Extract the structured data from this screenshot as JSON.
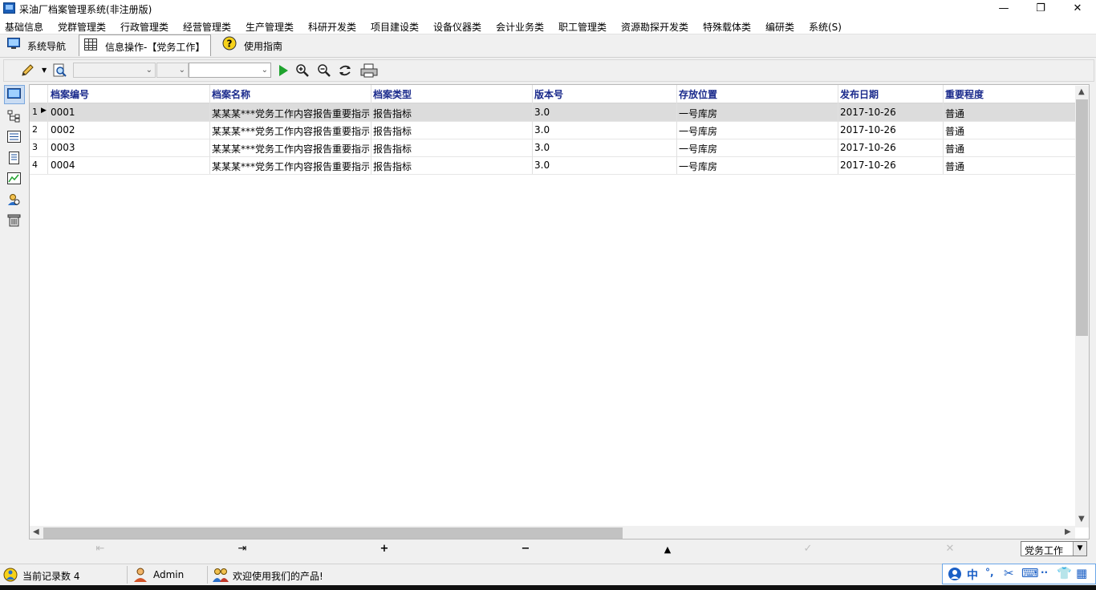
{
  "window": {
    "title": "采油厂档案管理系统(非注册版)",
    "minimize": "—",
    "restore": "❐",
    "close": "✕"
  },
  "menu": [
    "基础信息",
    "党群管理类",
    "行政管理类",
    "经营管理类",
    "生产管理类",
    "科研开发类",
    "项目建设类",
    "设备仪器类",
    "会计业务类",
    "职工管理类",
    "资源勘探开发类",
    "特殊载体类",
    "编研类",
    "系统(S)"
  ],
  "tabs": {
    "nav": "系统导航",
    "info": "信息操作-【党务工作】",
    "guide": "使用指南"
  },
  "table": {
    "columns": [
      "档案编号",
      "档案名称",
      "档案类型",
      "版本号",
      "存放位置",
      "发布日期",
      "重要程度"
    ],
    "rows": [
      {
        "num": "1",
        "id": "0001",
        "name": "某某某***党务工作内容报告重要指示",
        "type": "报告指标",
        "version": "3.0",
        "location": "一号库房",
        "date": "2017-10-26",
        "level": "普通"
      },
      {
        "num": "2",
        "id": "0002",
        "name": "某某某***党务工作内容报告重要指示",
        "type": "报告指标",
        "version": "3.0",
        "location": "一号库房",
        "date": "2017-10-26",
        "level": "普通"
      },
      {
        "num": "3",
        "id": "0003",
        "name": "某某某***党务工作内容报告重要指示",
        "type": "报告指标",
        "version": "3.0",
        "location": "一号库房",
        "date": "2017-10-26",
        "level": "普通"
      },
      {
        "num": "4",
        "id": "0004",
        "name": "某某某***党务工作内容报告重要指示",
        "type": "报告指标",
        "version": "3.0",
        "location": "一号库房",
        "date": "2017-10-26",
        "level": "普通"
      }
    ]
  },
  "navigator": {
    "filter_value": "党务工作"
  },
  "status": {
    "record_count": "当前记录数 4",
    "user": "Admin",
    "welcome": "欢迎使用我们的产品!"
  },
  "ime": {
    "lang": "中",
    "punct": "°,",
    "dots": "··"
  }
}
